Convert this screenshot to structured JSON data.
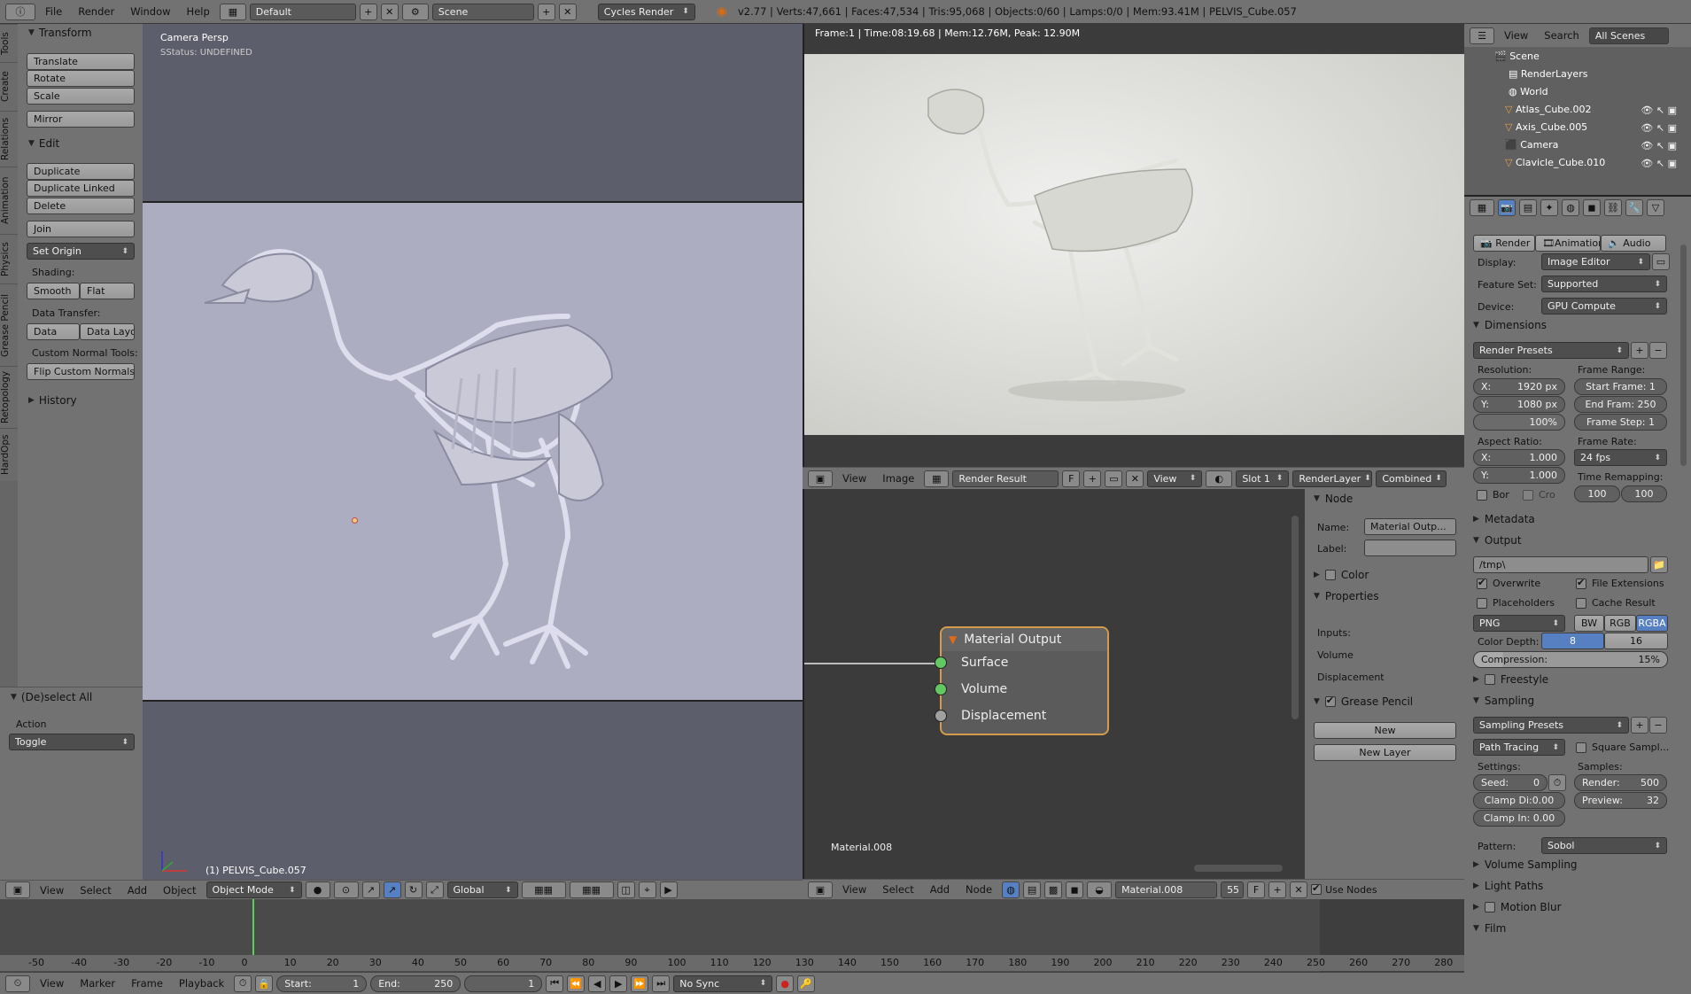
{
  "topbar": {
    "menus": [
      "File",
      "Render",
      "Window",
      "Help"
    ],
    "layout": "Default",
    "scene": "Scene",
    "engine": "Cycles Render",
    "stats": "v2.77 | Verts:47,661 | Faces:47,534 | Tris:95,068 | Objects:0/60 | Lamps:0/0 | Mem:93.41M | PELVIS_Cube.057"
  },
  "tool_tabs": [
    "Tools",
    "Create",
    "Relations",
    "Animation",
    "Physics",
    "Grease Pencil",
    "Retopology",
    "HardOps"
  ],
  "tools": {
    "transform_title": "Transform",
    "translate": "Translate",
    "rotate": "Rotate",
    "scale": "Scale",
    "mirror": "Mirror",
    "edit_title": "Edit",
    "duplicate": "Duplicate",
    "duplicate_linked": "Duplicate Linked",
    "delete": "Delete",
    "join": "Join",
    "set_origin": "Set Origin",
    "shading_label": "Shading:",
    "smooth": "Smooth",
    "flat": "Flat",
    "data_transfer_label": "Data Transfer:",
    "data": "Data",
    "data_layo": "Data Layo",
    "custom_normal_label": "Custom Normal Tools:",
    "flip_normals": "Flip Custom Normals",
    "history": "History"
  },
  "operator": {
    "title": "(De)select All",
    "action_label": "Action",
    "action_value": "Toggle"
  },
  "viewport": {
    "view_name": "Camera Persp",
    "status": "SStatus: UNDEFINED",
    "object_label": "(1) PELVIS_Cube.057",
    "menus": [
      "View",
      "Select",
      "Add",
      "Object"
    ],
    "mode": "Object Mode",
    "orientation": "Global"
  },
  "render": {
    "info": "Frame:1 | Time:08:19.68 | Mem:12.76M, Peak: 12.90M",
    "menus": [
      "View",
      "Image"
    ],
    "image_name": "Render Result",
    "f_label": "F",
    "view_label": "View",
    "slot": "Slot 1",
    "layer": "RenderLayer",
    "pass": "Combined"
  },
  "node_editor": {
    "node_title": "Material Output",
    "sockets": [
      "Surface",
      "Volume",
      "Displacement"
    ],
    "material_label": "Material.008",
    "menus": [
      "View",
      "Select",
      "Add",
      "Node"
    ],
    "material": "Material.008",
    "users": "55",
    "f_label": "F",
    "use_nodes": "Use Nodes"
  },
  "node_panel": {
    "node_title": "Node",
    "name_label": "Name:",
    "name_value": "Material Outp...",
    "label_label": "Label:",
    "color_title": "Color",
    "properties_title": "Properties",
    "inputs_label": "Inputs:",
    "volume_label": "Volume",
    "displacement_label": "Displacement",
    "grease_title": "Grease Pencil",
    "new_button": "New",
    "new_layer_button": "New Layer"
  },
  "outliner": {
    "menus": [
      "View",
      "Search"
    ],
    "filter": "All Scenes",
    "items": [
      "Scene",
      "RenderLayers",
      "World",
      "Atlas_Cube.002",
      "Axis_Cube.005",
      "Camera",
      "Clavicle_Cube.010"
    ]
  },
  "properties": {
    "tab_render": "Render",
    "tab_animation": "Animation",
    "tab_audio": "Audio",
    "display_label": "Display:",
    "display_value": "Image Editor",
    "feature_label": "Feature Set:",
    "feature_value": "Supported",
    "device_label": "Device:",
    "device_value": "GPU Compute",
    "dimensions_title": "Dimensions",
    "render_presets": "Render Presets",
    "resolution_label": "Resolution:",
    "res_x": "1920 px",
    "res_y": "1080 px",
    "res_pct": "100%",
    "frame_range_label": "Frame Range:",
    "start_frame": "Start Frame: 1",
    "end_frame": "End Fram: 250",
    "frame_step": "Frame Step: 1",
    "aspect_label": "Aspect Ratio:",
    "asp_x": "1.000",
    "asp_y": "1.000",
    "frame_rate_label": "Frame Rate:",
    "fps": "24 fps",
    "remap_label": "Time Remapping:",
    "remap_old": "100",
    "remap_new": "100",
    "bor": "Bor",
    "cro": "Cro",
    "metadata_title": "Metadata",
    "output_title": "Output",
    "output_path": "/tmp\\",
    "overwrite": "Overwrite",
    "file_ext": "File Extensions",
    "placeholders": "Placeholders",
    "cache": "Cache Result",
    "format": "PNG",
    "bw": "BW",
    "rgb": "RGB",
    "rgba": "RGBA",
    "depth_label": "Color Depth:",
    "depth_8": "8",
    "depth_16": "16",
    "compression": "Compression:",
    "compression_val": "15%",
    "freestyle_title": "Freestyle",
    "sampling_title": "Sampling",
    "sampling_presets": "Sampling Presets",
    "path_tracing": "Path Tracing",
    "square_samples": "Square Sampl...",
    "settings_label": "Settings:",
    "samples_label": "Samples:",
    "seed_label": "Seed:",
    "seed_val": "0",
    "render_label": "Render:",
    "render_val": "500",
    "clamp_di": "Clamp Di:0.00",
    "preview_label": "Preview:",
    "preview_val": "32",
    "clamp_in": "Clamp In: 0.00",
    "pattern_label": "Pattern:",
    "pattern_value": "Sobol",
    "volume_sampling": "Volume Sampling",
    "light_paths": "Light Paths",
    "motion_blur": "Motion Blur",
    "film": "Film"
  },
  "timeline": {
    "ticks": [
      "-50",
      "-40",
      "-30",
      "-20",
      "-10",
      "0",
      "10",
      "20",
      "30",
      "40",
      "50",
      "60",
      "70",
      "80",
      "90",
      "100",
      "110",
      "120",
      "130",
      "140",
      "150",
      "160",
      "170",
      "180",
      "190",
      "200",
      "210",
      "220",
      "230",
      "240",
      "250",
      "260",
      "270",
      "280"
    ],
    "menus": [
      "View",
      "Marker",
      "Frame",
      "Playback"
    ],
    "start": "Start:",
    "start_val": "1",
    "end": "End:",
    "end_val": "250",
    "current": "1",
    "sync": "No Sync"
  }
}
